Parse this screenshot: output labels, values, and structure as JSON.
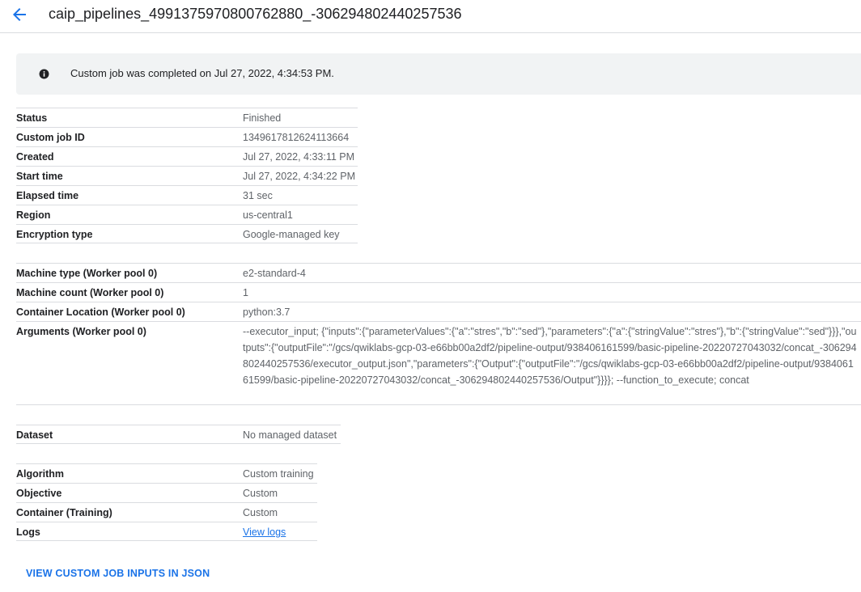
{
  "header": {
    "title": "caip_pipelines_4991375970800762880_-306294802440257536"
  },
  "banner": {
    "icon": "info-icon",
    "message": "Custom job was completed on Jul 27, 2022, 4:34:53 PM."
  },
  "job_details": [
    {
      "key": "Status",
      "value": "Finished"
    },
    {
      "key": "Custom job ID",
      "value": "1349617812624113664"
    },
    {
      "key": "Created",
      "value": "Jul 27, 2022, 4:33:11 PM"
    },
    {
      "key": "Start time",
      "value": "Jul 27, 2022, 4:34:22 PM"
    },
    {
      "key": "Elapsed time",
      "value": "31 sec"
    },
    {
      "key": "Region",
      "value": "us-central1"
    },
    {
      "key": "Encryption type",
      "value": "Google-managed key"
    }
  ],
  "worker_pool": [
    {
      "key": "Machine type (Worker pool 0)",
      "value": "e2-standard-4"
    },
    {
      "key": "Machine count (Worker pool 0)",
      "value": "1"
    },
    {
      "key": "Container Location (Worker pool 0)",
      "value": "python:3.7"
    },
    {
      "key": "Arguments (Worker pool 0)",
      "value": "--executor_input; {\"inputs\":{\"parameterValues\":{\"a\":\"stres\",\"b\":\"sed\"},\"parameters\":{\"a\":{\"stringValue\":\"stres\"},\"b\":{\"stringValue\":\"sed\"}}},\"outputs\":{\"outputFile\":\"/gcs/qwiklabs-gcp-03-e66bb00a2df2/pipeline-output/938406161599/basic-pipeline-20220727043032/concat_-306294802440257536/executor_output.json\",\"parameters\":{\"Output\":{\"outputFile\":\"/gcs/qwiklabs-gcp-03-e66bb00a2df2/pipeline-output/938406161599/basic-pipeline-20220727043032/concat_-306294802440257536/Output\"}}}}; --function_to_execute; concat"
    }
  ],
  "dataset": [
    {
      "key": "Dataset",
      "value": "No managed dataset"
    }
  ],
  "training": [
    {
      "key": "Algorithm",
      "value": "Custom training"
    },
    {
      "key": "Objective",
      "value": "Custom"
    },
    {
      "key": "Container (Training)",
      "value": "Custom"
    },
    {
      "key": "Logs",
      "value": "View logs"
    }
  ],
  "actions": {
    "view_json_label": "VIEW CUSTOM JOB INPUTS IN JSON"
  },
  "colors": {
    "accent": "#1a73e8",
    "banner_bg": "#f1f3f4",
    "divider": "#dadce0"
  }
}
